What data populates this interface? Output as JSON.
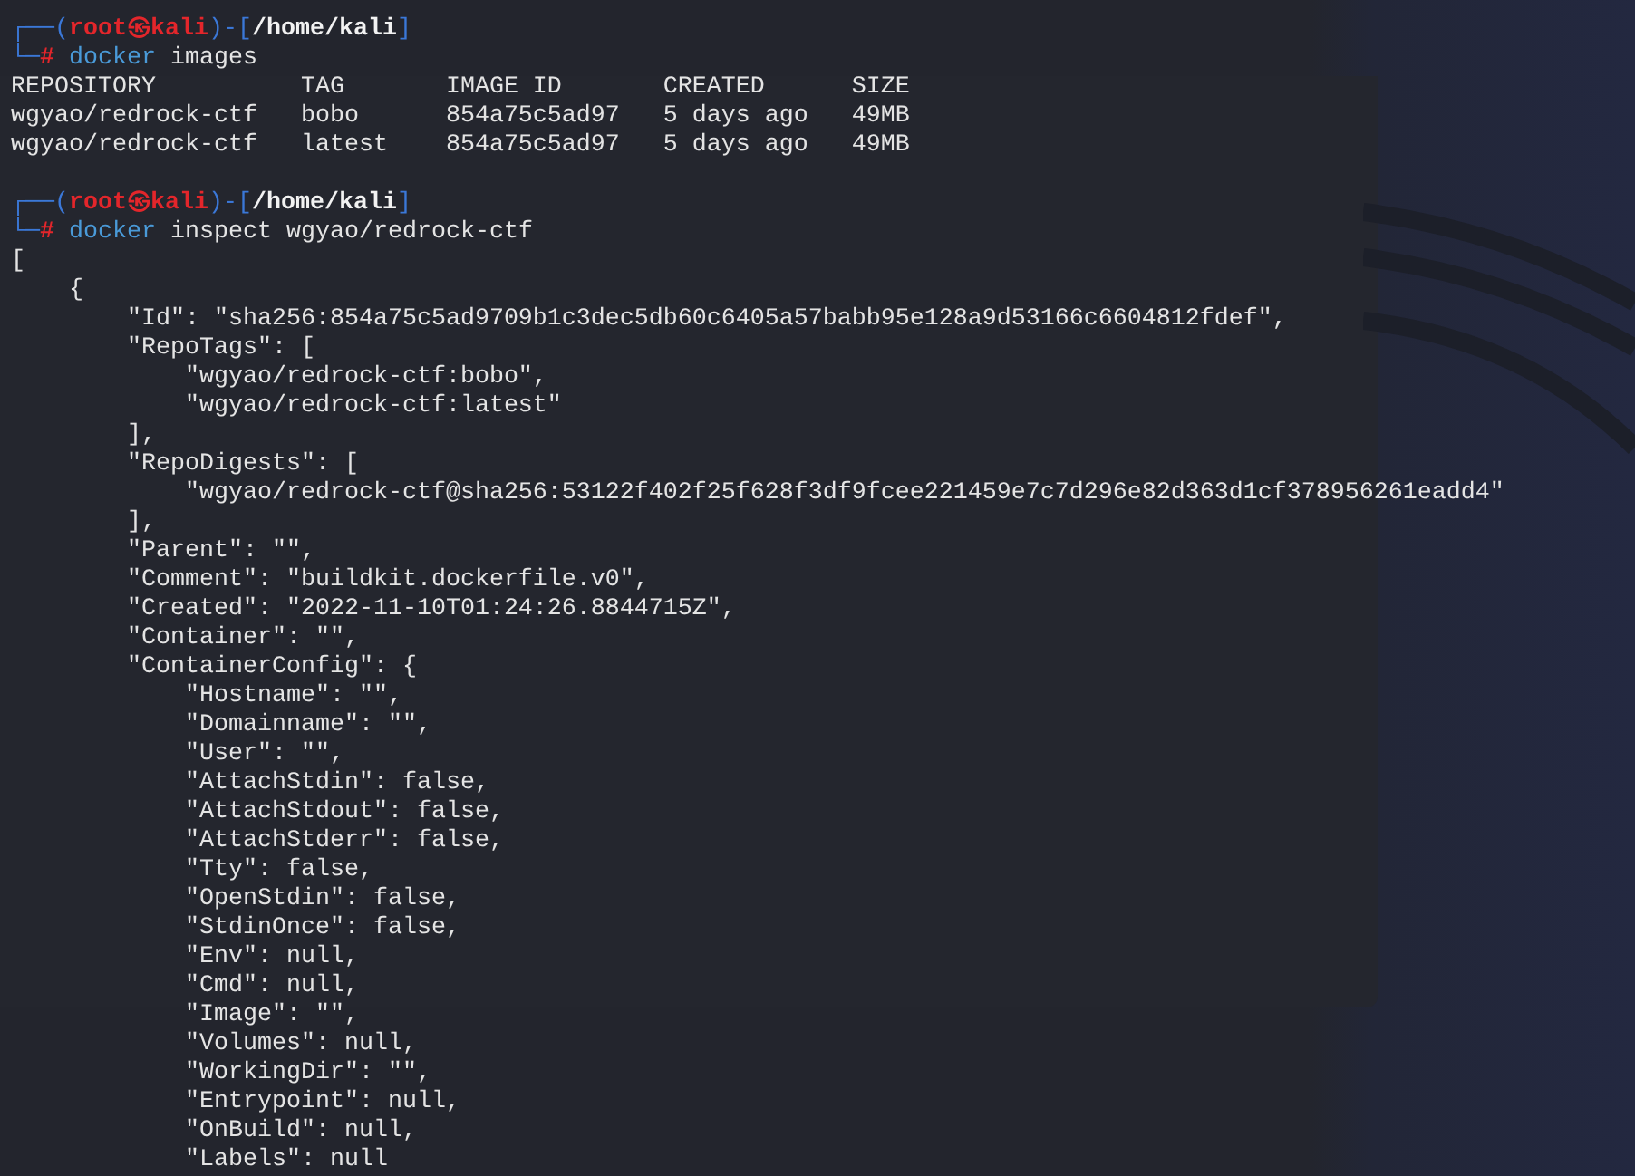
{
  "terminal": {
    "blocks": [
      {
        "kind": "prompt",
        "line1": [
          {
            "kind": "frame",
            "text": "┌──("
          },
          {
            "kind": "user",
            "text": "root㉿kali"
          },
          {
            "kind": "frame",
            "text": ")-["
          },
          {
            "kind": "path",
            "text": "/home/kali"
          },
          {
            "kind": "frame",
            "text": "]"
          }
        ],
        "line2": [
          {
            "kind": "frame",
            "text": "└─"
          },
          {
            "kind": "hash",
            "text": "#"
          },
          {
            "kind": "command",
            "text": " docker"
          },
          {
            "kind": "plain",
            "text": " images"
          }
        ]
      },
      {
        "kind": "output",
        "lines": [
          "REPOSITORY          TAG       IMAGE ID       CREATED      SIZE",
          "wgyao/redrock-ctf   bobo      854a75c5ad97   5 days ago   49MB",
          "wgyao/redrock-ctf   latest    854a75c5ad97   5 days ago   49MB"
        ]
      },
      {
        "kind": "prompt",
        "line1": [
          {
            "kind": "frame",
            "text": "┌──("
          },
          {
            "kind": "user",
            "text": "root㉿kali"
          },
          {
            "kind": "frame",
            "text": ")-["
          },
          {
            "kind": "path",
            "text": "/home/kali"
          },
          {
            "kind": "frame",
            "text": "]"
          }
        ],
        "line2": [
          {
            "kind": "frame",
            "text": "└─"
          },
          {
            "kind": "hash",
            "text": "#"
          },
          {
            "kind": "command",
            "text": " docker"
          },
          {
            "kind": "plain",
            "text": " inspect wgyao/redrock-ctf"
          }
        ]
      },
      {
        "kind": "output",
        "lines": [
          "[",
          "    {",
          "        \"Id\": \"sha256:854a75c5ad9709b1c3dec5db60c6405a57babb95e128a9d53166c6604812fdef\",",
          "        \"RepoTags\": [",
          "            \"wgyao/redrock-ctf:bobo\",",
          "            \"wgyao/redrock-ctf:latest\"",
          "        ],",
          "        \"RepoDigests\": [",
          "            \"wgyao/redrock-ctf@sha256:53122f402f25f628f3df9fcee221459e7c7d296e82d363d1cf378956261eadd4\"",
          "        ],",
          "        \"Parent\": \"\",",
          "        \"Comment\": \"buildkit.dockerfile.v0\",",
          "        \"Created\": \"2022-11-10T01:24:26.8844715Z\",",
          "        \"Container\": \"\",",
          "        \"ContainerConfig\": {",
          "            \"Hostname\": \"\",",
          "            \"Domainname\": \"\",",
          "            \"User\": \"\",",
          "            \"AttachStdin\": false,",
          "            \"AttachStdout\": false,",
          "            \"AttachStderr\": false,",
          "            \"Tty\": false,",
          "            \"OpenStdin\": false,",
          "            \"StdinOnce\": false,",
          "            \"Env\": null,",
          "            \"Cmd\": null,",
          "            \"Image\": \"\",",
          "            \"Volumes\": null,",
          "            \"WorkingDir\": \"\",",
          "            \"Entrypoint\": null,",
          "            \"OnBuild\": null,",
          "            \"Labels\": null"
        ]
      }
    ]
  }
}
